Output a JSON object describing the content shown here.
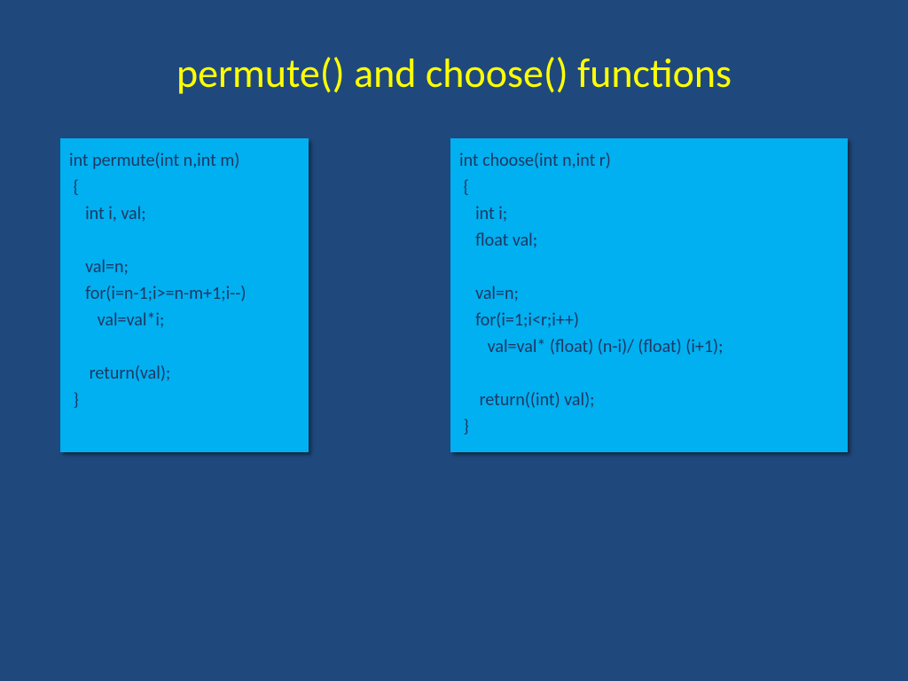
{
  "title": "permute() and choose() functions",
  "left": {
    "l1": "int permute(int n,int m)",
    "l2": " {",
    "l3": "    int i, val;",
    "l4": "",
    "l5": "    val=n;",
    "l6": "    for(i=n-1;i>=n-m+1;i--)",
    "l7": "       val=val*i;",
    "l8": "",
    "l9": "     return(val);",
    "l10": " }"
  },
  "right": {
    "l1": "int choose(int n,int r)",
    "l2": " {",
    "l3": "    int i;",
    "l4": "    float val;",
    "l5": "",
    "l6": "    val=n;",
    "l7": "    for(i=1;i<r;i++)",
    "l8": "       val=val* (float) (n-i)/ (float) (i+1);",
    "l9": "",
    "l10": "     return((int) val);",
    "l11": " }"
  }
}
